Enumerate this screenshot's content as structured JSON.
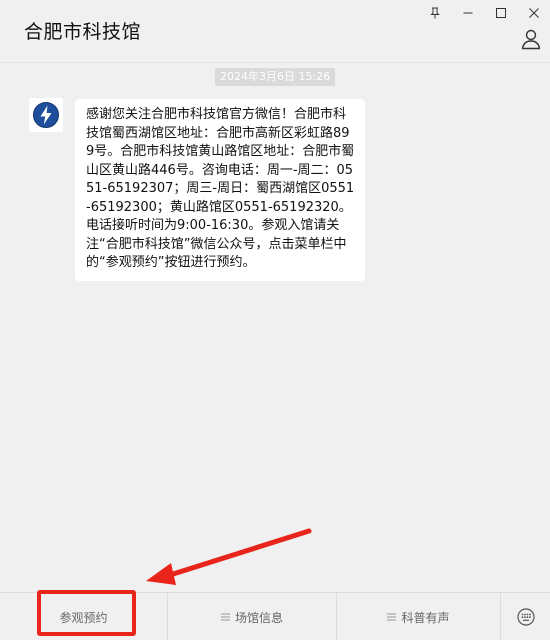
{
  "window": {
    "title": "合肥市科技馆",
    "controls": [
      "pin-icon",
      "minimize-icon",
      "maximize-icon",
      "close-icon"
    ]
  },
  "chat": {
    "timestamp": "2024年3月6日 15:26",
    "message": "感谢您关注合肥市科技馆官方微信！合肥市科技馆蜀西湖馆区地址：合肥市高新区彩虹路899号。合肥市科技馆黄山路馆区地址：合肥市蜀山区黄山路446号。咨询电话：周一-周二：0551-65192307；周三-周日：蜀西湖馆区0551-65192300；黄山路馆区0551-65192320。电话接听时间为9:00-16:30。参观入馆请关注“合肥市科技馆”微信公众号，点击菜单栏中的“参观预约”按钮进行预约。"
  },
  "menu": {
    "items": [
      {
        "label": "参观预约",
        "has_submenu": false
      },
      {
        "label": "场馆信息",
        "has_submenu": true
      },
      {
        "label": "科普有声",
        "has_submenu": true
      }
    ],
    "keyboard_icon": "keyboard-icon"
  },
  "colors": {
    "background": "#f0f0f0",
    "bubble": "#ffffff",
    "annotation": "#e8241b",
    "logo_blue": "#1d4f9c"
  }
}
